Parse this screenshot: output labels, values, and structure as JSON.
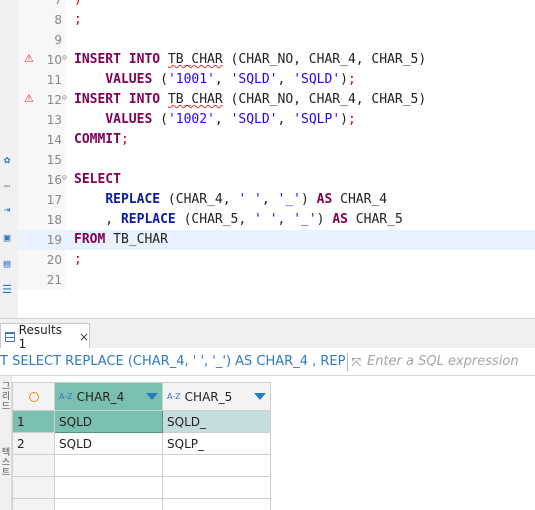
{
  "editor": {
    "lines": [
      {
        "num": "7",
        "text": ")"
      },
      {
        "num": "8",
        "text": ";"
      },
      {
        "num": "9",
        "text": ""
      },
      {
        "num": "10",
        "text": "INSERT INTO TB_CHAR (CHAR_NO, CHAR_4, CHAR_5)"
      },
      {
        "num": "11",
        "text": "    VALUES ('1001', 'SQLD', 'SQLD');"
      },
      {
        "num": "12",
        "text": "INSERT INTO TB_CHAR (CHAR_NO, CHAR_4, CHAR_5)"
      },
      {
        "num": "13",
        "text": "    VALUES ('1002', 'SQLD', 'SQLP');"
      },
      {
        "num": "14",
        "text": "COMMIT;"
      },
      {
        "num": "15",
        "text": ""
      },
      {
        "num": "16",
        "text": "SELECT"
      },
      {
        "num": "17",
        "text": "    REPLACE (CHAR_4, ' ', '_') AS CHAR_4"
      },
      {
        "num": "18",
        "text": "    , REPLACE (CHAR_5, ' ', '_') AS CHAR_5"
      },
      {
        "num": "19",
        "text": "FROM TB_CHAR"
      },
      {
        "num": "20",
        "text": ";"
      },
      {
        "num": "21",
        "text": ""
      }
    ]
  },
  "results": {
    "tab_label": "Results 1",
    "close_icon": "×",
    "query_text": "T SELECT REPLACE (CHAR_4, ' ', '_') AS CHAR_4 , REPLACE",
    "filter_placeholder": "Enter a SQL expression",
    "columns": [
      {
        "label": "CHAR_4",
        "type_icon": "A-Z"
      },
      {
        "label": "CHAR_5",
        "type_icon": "A-Z"
      }
    ],
    "rows": [
      {
        "num": "1",
        "char_4": "SQLD",
        "char_5": "SQLD_"
      },
      {
        "num": "2",
        "char_4": "SQLD",
        "char_5": "SQLP_"
      }
    ],
    "side_tabs": [
      "그리드",
      "텍스트"
    ]
  },
  "colors": {
    "selected_header": "#7bbfb0",
    "current_line": "#e8f2fe",
    "keyword": "#7f0055",
    "string": "#2a00ff"
  }
}
